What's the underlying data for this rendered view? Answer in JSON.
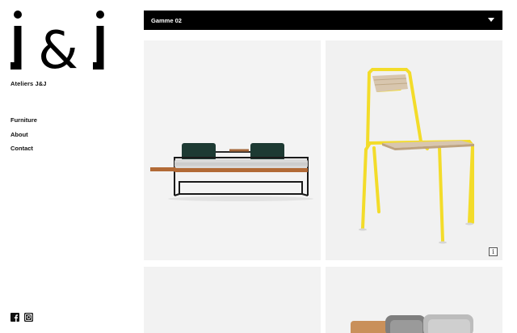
{
  "brand": {
    "logo_text": "j&j",
    "name": "Ateliers J&J"
  },
  "nav": {
    "items": [
      {
        "label": "Furniture"
      },
      {
        "label": "About"
      },
      {
        "label": "Contact"
      }
    ]
  },
  "social": {
    "icons": [
      "facebook-icon",
      "instagram-icon"
    ]
  },
  "gallery": {
    "selector_label": "Gamme 02",
    "caret_icon": "caret-down-icon",
    "info_label": "i",
    "items": [
      {
        "subject": "daybed-sofa"
      },
      {
        "subject": "yellow-chair"
      },
      {
        "subject": "furniture-image"
      },
      {
        "subject": "cushioned-seating"
      }
    ]
  },
  "colors": {
    "bar": "#000000",
    "text": "#111111",
    "tile_bg": "#f2f2f2",
    "chair_yellow": "#f3dc2a",
    "sofa_green": "#1d3a33",
    "wood": "#b26a36"
  }
}
